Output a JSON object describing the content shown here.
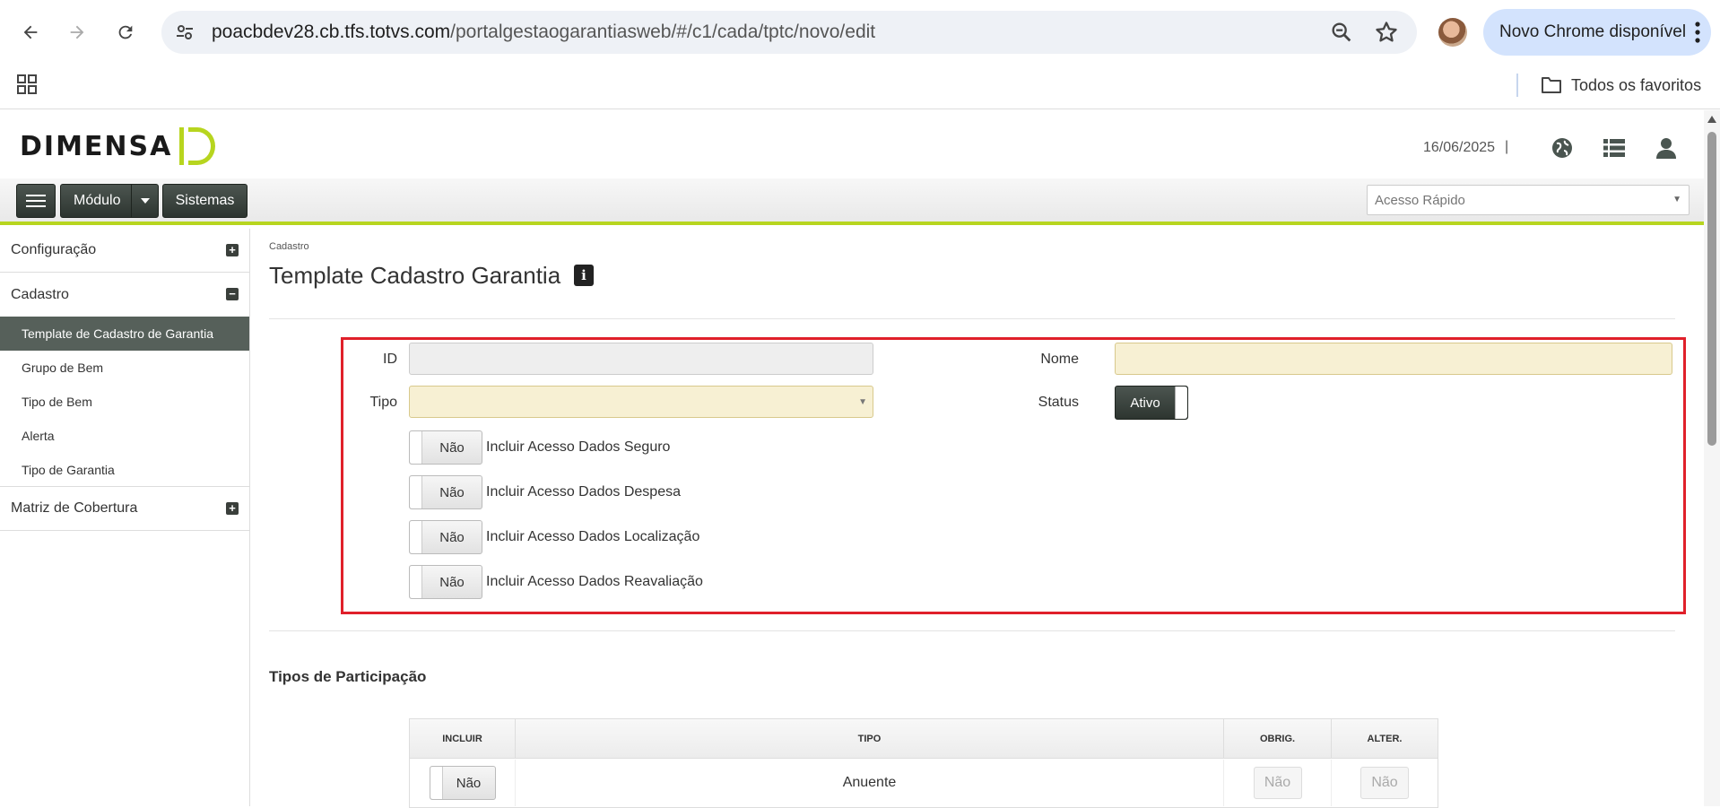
{
  "browser": {
    "url_domain": "poacbdev28.cb.tfs.totvs.com",
    "url_path": "/portalgestaogarantiasweb/#/c1/cada/tptc/novo/edit",
    "update_label": "Novo Chrome disponível",
    "all_bookmarks_label": "Todos os favoritos"
  },
  "header": {
    "logo_text": "DIMENSA",
    "date": "16/06/2025",
    "separator": "|"
  },
  "toolbar": {
    "modulo_label": "Módulo",
    "sistemas_label": "Sistemas",
    "quick_access_placeholder": "Acesso Rápido"
  },
  "sidebar": {
    "groups": [
      {
        "label": "Configuração",
        "toggle": "+"
      },
      {
        "label": "Cadastro",
        "toggle": "−"
      },
      {
        "label": "Matriz de Cobertura",
        "toggle": "+"
      }
    ],
    "items": [
      {
        "label": "Template de Cadastro de Garantia"
      },
      {
        "label": "Grupo de Bem"
      },
      {
        "label": "Tipo de Bem"
      },
      {
        "label": "Alerta"
      },
      {
        "label": "Tipo de Garantia"
      }
    ]
  },
  "main": {
    "breadcrumb": "Cadastro",
    "title": "Template Cadastro Garantia",
    "info_glyph": "i",
    "form": {
      "id_label": "ID",
      "id_value": "",
      "nome_label": "Nome",
      "nome_value": "",
      "tipo_label": "Tipo",
      "tipo_value": "",
      "status_label": "Status",
      "status_value": "Ativo",
      "options": [
        {
          "label": "Incluir Acesso Dados Seguro",
          "value": "Não"
        },
        {
          "label": "Incluir Acesso Dados Despesa",
          "value": "Não"
        },
        {
          "label": "Incluir Acesso Dados Localização",
          "value": "Não"
        },
        {
          "label": "Incluir Acesso Dados Reavaliação",
          "value": "Não"
        }
      ]
    },
    "participacao": {
      "title": "Tipos de Participação",
      "columns": [
        "INCLUIR",
        "TIPO",
        "OBRIG.",
        "ALTER."
      ],
      "rows": [
        {
          "incluir": "Não",
          "tipo": "Anuente",
          "obrig": "Não",
          "alter": "Não"
        }
      ]
    }
  }
}
